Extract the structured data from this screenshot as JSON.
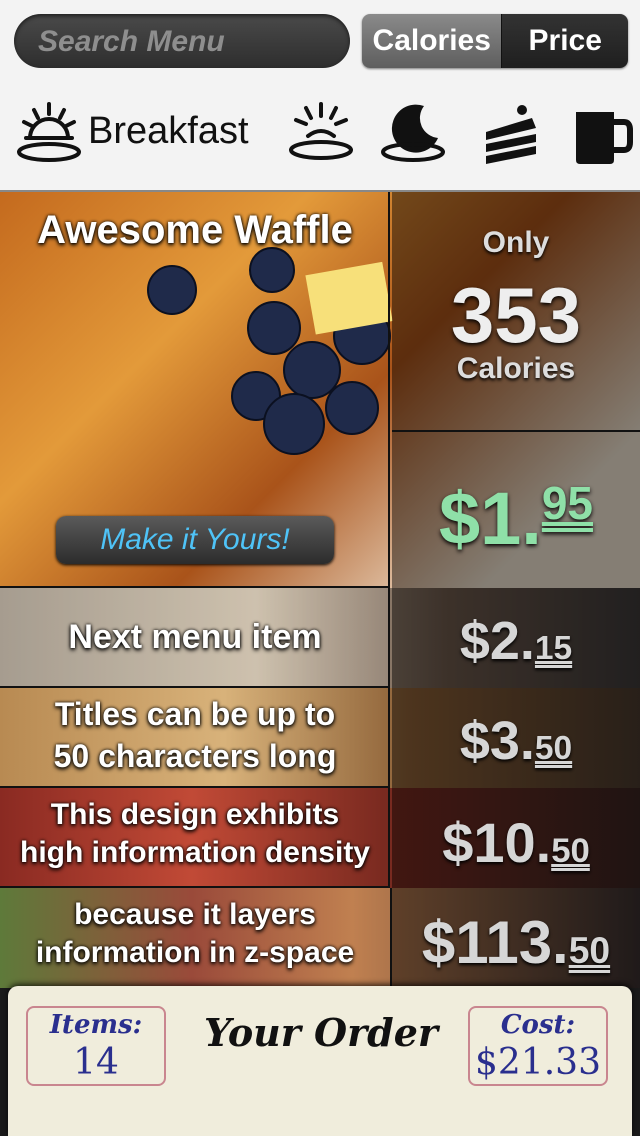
{
  "search": {
    "placeholder": "Search Menu"
  },
  "sort": {
    "calories": "Calories",
    "price": "Price"
  },
  "categories": {
    "current": "Breakfast",
    "icons": [
      "sunrise-plate-icon",
      "sun-plate-icon",
      "moon-plate-icon",
      "cake-icon",
      "mug-icon"
    ]
  },
  "featured": {
    "title": "Awesome Waffle",
    "only": "Only",
    "calories_value": "353",
    "calories_label": "Calories",
    "price_dollars": "$1.",
    "price_cents": "95",
    "make_it_yours": "Make it Yours!"
  },
  "items": [
    {
      "title_line1": "Next menu item",
      "title_line2": "",
      "dollars": "$2.",
      "cents": "15"
    },
    {
      "title_line1": "Titles can be up to",
      "title_line2": "50 characters long",
      "dollars": "$3.",
      "cents": "50"
    },
    {
      "title_line1": "This design exhibits",
      "title_line2": "high information density",
      "dollars": "$10.",
      "cents": "50"
    },
    {
      "title_line1": "because it layers",
      "title_line2": "information in z-space",
      "dollars": "$113.",
      "cents": "50"
    }
  ],
  "order": {
    "items_label": "Items:",
    "items_value": "14",
    "title": "Your Order",
    "cost_label": "Cost:",
    "cost_value": "$21.33"
  },
  "colors": {
    "price_accent": "#8fe0a8",
    "link_blue": "#4fc3f7"
  }
}
